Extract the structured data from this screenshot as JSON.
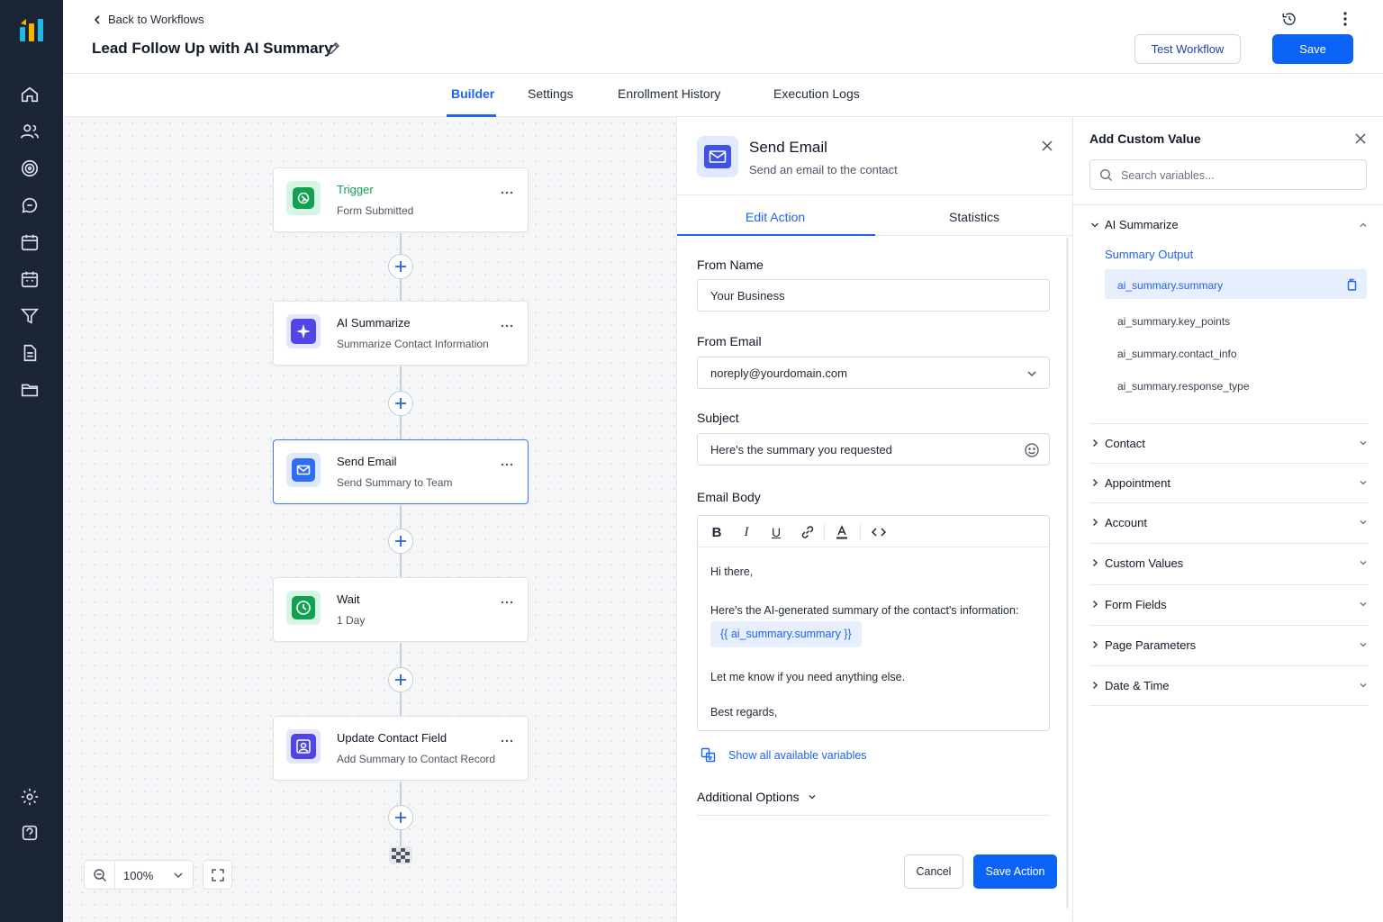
{
  "header": {
    "back_label": "Back to Workflows",
    "title": "Lead Follow Up with AI Summary",
    "test_label": "Test Workflow",
    "save_label": "Save"
  },
  "tabs": {
    "builder": "Builder",
    "settings": "Settings",
    "enrollment": "Enrollment History",
    "logs": "Execution Logs"
  },
  "workflow": {
    "nodes": [
      {
        "title": "Trigger",
        "subtitle": "Form Submitted",
        "icon": "trigger-icon",
        "color": "#12a150"
      },
      {
        "title": "AI Summarize",
        "subtitle": "Summarize Contact Information",
        "icon": "sparkle-icon",
        "color": "#4f46e5"
      },
      {
        "title": "Send Email",
        "subtitle": "Send Summary to Team",
        "icon": "mail-icon",
        "color": "#2f6df6"
      },
      {
        "title": "Wait",
        "subtitle": "1 Day",
        "icon": "clock-icon",
        "color": "#12a150"
      },
      {
        "title": "Update Contact Field",
        "subtitle": "Add Summary to Contact Record",
        "icon": "contact-icon",
        "color": "#4f46e5"
      }
    ],
    "zoom": "100%"
  },
  "action_panel": {
    "title": "Send Email",
    "subtitle": "Send an email to the contact",
    "tab_edit": "Edit Action",
    "tab_stats": "Statistics",
    "from_name_label": "From Name",
    "from_name_value": "Your Business",
    "from_email_label": "From Email",
    "from_email_value": "noreply@yourdomain.com",
    "subject_label": "Subject",
    "subject_value": "Here's the summary you requested",
    "body_label": "Email Body",
    "body": {
      "line1": "Hi there,",
      "line2": "Here's the AI-generated summary of the contact's information:",
      "variable": "{{ ai_summary.summary }}",
      "line3": "Let me know if you need anything else.",
      "line4": "Best regards,"
    },
    "show_vars": "Show all available variables",
    "additional_options": "Additional Options",
    "cancel": "Cancel",
    "save_action": "Save Action"
  },
  "custom_values": {
    "title": "Add Custom Value",
    "search_placeholder": "Search variables...",
    "group": "AI Summarize",
    "sub_label": "Summary Output",
    "items": [
      "ai_summary.summary",
      "ai_summary.key_points",
      "ai_summary.contact_info",
      "ai_summary.response_type"
    ],
    "categories": [
      "Contact",
      "Appointment",
      "Account",
      "Custom Values",
      "Form Fields",
      "Page Parameters",
      "Date & Time"
    ]
  },
  "colors": {
    "primary": "#0b63f6",
    "accent": "#1d64f2",
    "sidebar": "#1b2536"
  }
}
